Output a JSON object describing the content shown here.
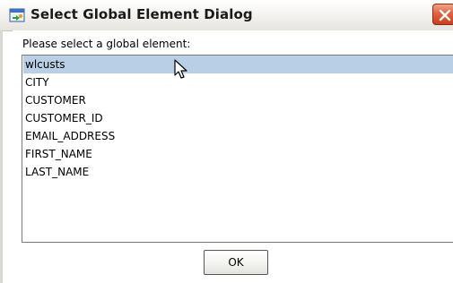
{
  "dialog": {
    "title": "Select Global Element Dialog",
    "prompt": "Please select a global element:",
    "items": [
      {
        "label": "wlcusts",
        "selected": true
      },
      {
        "label": "CITY",
        "selected": false
      },
      {
        "label": "CUSTOMER",
        "selected": false
      },
      {
        "label": "CUSTOMER_ID",
        "selected": false
      },
      {
        "label": "EMAIL_ADDRESS",
        "selected": false
      },
      {
        "label": "FIRST_NAME",
        "selected": false
      },
      {
        "label": "LAST_NAME",
        "selected": false
      }
    ],
    "ok_label": "OK",
    "icons": {
      "app": "dialog-app-icon",
      "close": "close-icon",
      "cursor": "mouse-pointer-icon"
    },
    "colors": {
      "selection": "#b8cfe5",
      "close": "#e2623f"
    }
  }
}
